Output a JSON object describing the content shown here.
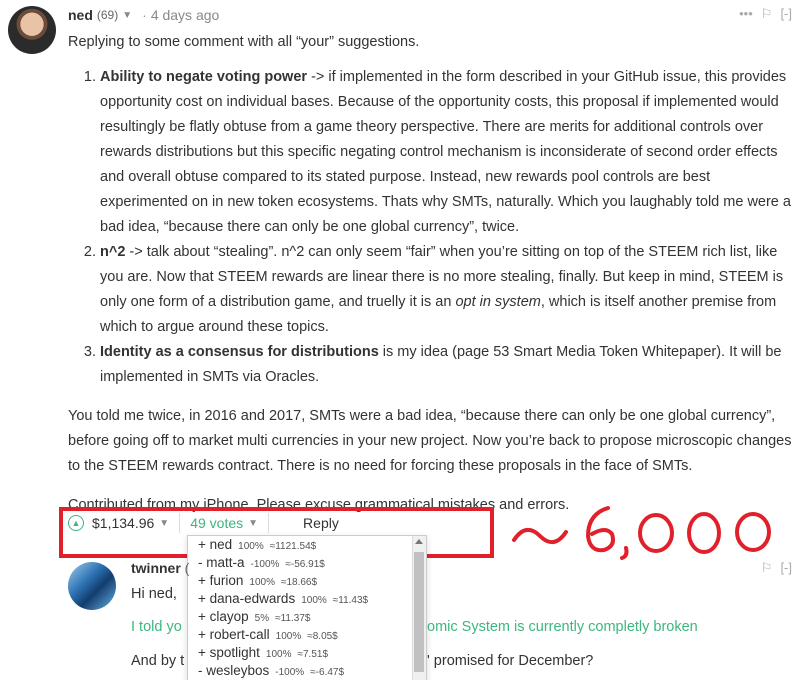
{
  "comment": {
    "author": "ned",
    "reputation": "(69)",
    "time": "4 days ago",
    "tools": {
      "more": "•••",
      "flag": "⚐",
      "collapse": "[-]"
    },
    "intro": "Replying to some comment with all “your” suggestions.",
    "items": [
      {
        "bold": "Ability to negate voting power",
        "text": " -> if implemented in the form described in your GitHub issue, this provides opportunity cost on individual bases. Because of the opportunity costs, this proposal if implemented would resultingly be flatly obtuse from a game theory perspective. There are merits for additional controls over rewards distributions but this specific negating control mechanism is inconsiderate of second order effects and overall obtuse compared to its stated purpose. Instead, new rewards pool controls are best experimented on in new token ecosystems. Thats why SMTs, naturally. Which you laughably told me were a bad idea, “because there can only be one global currency”, twice."
      },
      {
        "bold": "n^2",
        "text": " -> talk about “stealing”. n^2 can only seem “fair” when you’re sitting on top of the STEEM rich list, like you are. Now that STEEM rewards are linear there is no more stealing, finally. But keep in mind, STEEM is only one form of a distribution game, and truelly it is an ",
        "italic": "opt in system",
        "text2": ", which is itself another premise from which to argue around these topics."
      },
      {
        "bold": "Identity as a consensus for distributions",
        "text": " is my idea (page 53 Smart Media Token Whitepaper). It will be implemented in SMTs via Oracles."
      }
    ],
    "para2": "You told me twice, in 2016 and 2017, SMTs were a bad idea, “because there can only be one global currency”, before going off to market multi currencies in your new project. Now you’re back to propose microscopic changes to the STEEM rewards contract. There is no need for forcing these proposals in the face of SMTs.",
    "para3": "Contributed from my iPhone. Please excuse grammatical mistakes and errors.",
    "payout": "$1,134.96",
    "votes": "49 votes",
    "reply": "Reply"
  },
  "annotation": {
    "text": "~6,000",
    "color": "#e0202a"
  },
  "votes_menu": [
    {
      "name": "+ ned",
      "pct": "100%",
      "val": "≈1121.54$"
    },
    {
      "name": "- matt-a",
      "pct": "-100%",
      "val": "≈-56.91$"
    },
    {
      "name": "+ furion",
      "pct": "100%",
      "val": "≈18.66$"
    },
    {
      "name": "+ dana-edwards",
      "pct": "100%",
      "val": "≈11.43$"
    },
    {
      "name": "+ clayop",
      "pct": "5%",
      "val": "≈11.37$"
    },
    {
      "name": "+ robert-call",
      "pct": "100%",
      "val": "≈8.05$"
    },
    {
      "name": "+ spotlight",
      "pct": "100%",
      "val": "≈7.51$"
    },
    {
      "name": "- wesleybos",
      "pct": "-100%",
      "val": "≈-6.47$"
    }
  ],
  "reply_comment": {
    "author": "twinner",
    "author_suffix": "(",
    "tools": {
      "flag": "⚐",
      "collapse": "[-]"
    },
    "line1": "Hi ned,",
    "line2_a": "I told yo",
    "line2_b": "omic System is currently completly broken",
    "line3_a": "And by t",
    "line3_b": "' promised for December?"
  },
  "colors": {
    "accent": "#3cb77d",
    "highlight": "#e0202a"
  }
}
